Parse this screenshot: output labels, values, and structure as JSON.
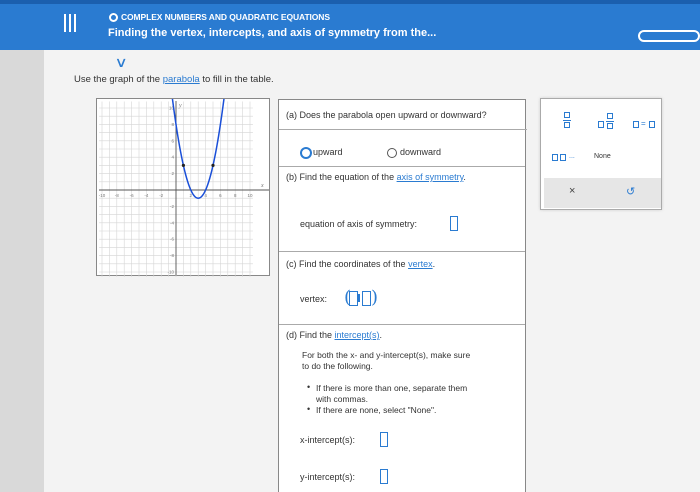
{
  "header": {
    "section_title": "COMPLEX NUMBERS AND QUADRATIC EQUATIONS",
    "topic_title": "Finding the vertex, intercepts, and axis of symmetry from the..."
  },
  "instructions": {
    "prefix": "Use the graph of the ",
    "link": "parabola",
    "suffix": " to fill in the table."
  },
  "graph": {
    "x_tick_labels": [
      "-10",
      "-8",
      "-6",
      "-4",
      "-2",
      "2",
      "4",
      "6",
      "8",
      "10"
    ],
    "y_tick_labels": [
      "10",
      "8",
      "6",
      "4",
      "2",
      "-2",
      "-4",
      "-6",
      "-8",
      "-10"
    ],
    "x_axis_label": "x",
    "y_axis_label": "y",
    "curve_color": "#1a4fd8",
    "vertex_approx": [
      3,
      -1
    ],
    "points": [
      [
        1,
        3
      ],
      [
        5,
        3
      ]
    ]
  },
  "table": {
    "a": {
      "question": "(a) Does the parabola open upward or downward?",
      "options": [
        "upward",
        "downward"
      ],
      "selected": "upward"
    },
    "b": {
      "question_prefix": "(b) Find the equation of the ",
      "question_link": "axis of symmetry",
      "question_suffix": ".",
      "field_label": "equation of axis of symmetry:"
    },
    "c": {
      "question_prefix": "(c) Find the coordinates of the ",
      "question_link": "vertex",
      "question_suffix": ".",
      "field_label": "vertex:"
    },
    "d": {
      "question_prefix": "(d) Find the ",
      "question_link": "intercept(s)",
      "question_suffix": ".",
      "instruction_line1": "For both the x- and y-intercept(s), make sure",
      "instruction_line2": "to do the following.",
      "bullet1_line1": "If there is more than one, separate them",
      "bullet1_line2": "with commas.",
      "bullet2": "If there are none, select \"None\".",
      "x_label": "x-intercept(s):",
      "y_label": "y-intercept(s):"
    }
  },
  "palette": {
    "comma_dots": ".",
    "ellipsis": "...",
    "equals": "=",
    "none_label": "None",
    "clear_symbol": "×",
    "undo_symbol": "↺"
  },
  "colors": {
    "header_bg": "#2a7bd1",
    "accent": "#2a7bd1",
    "page_bg": "#f3f3f3"
  }
}
